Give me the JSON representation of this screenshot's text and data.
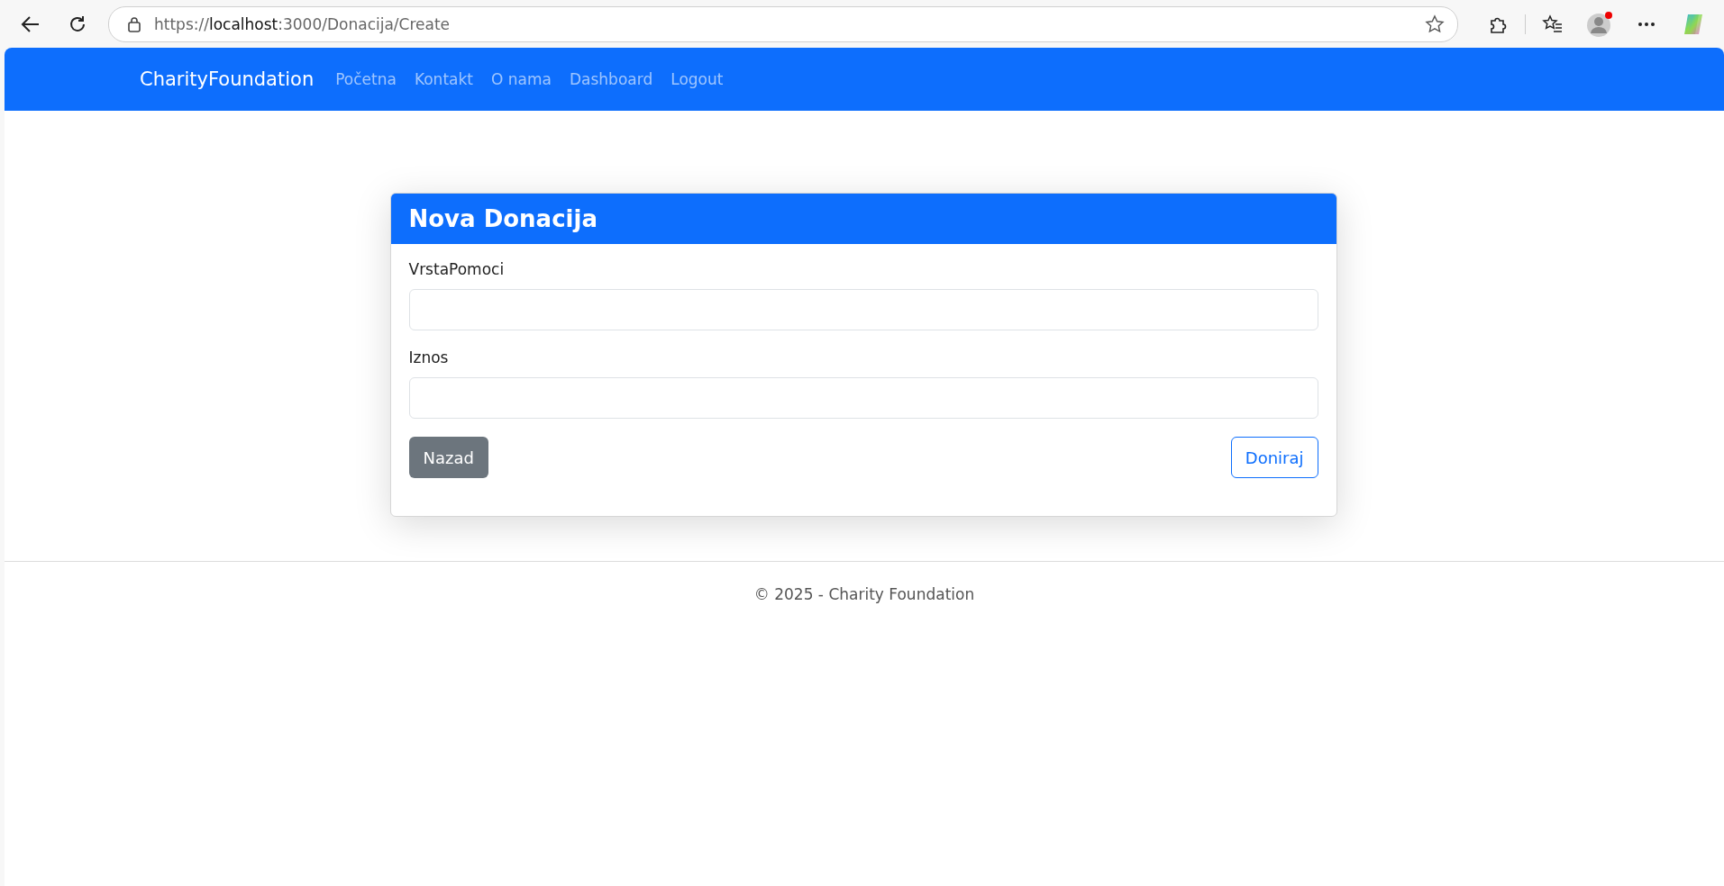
{
  "browser": {
    "url": {
      "scheme": "https://",
      "host": "localhost",
      "path": ":3000/Donacija/Create"
    }
  },
  "navbar": {
    "brand": "CharityFoundation",
    "links": [
      "Početna",
      "Kontakt",
      "O nama",
      "Dashboard",
      "Logout"
    ]
  },
  "card": {
    "title": "Nova Donacija",
    "fields": [
      {
        "label": "VrstaPomoci"
      },
      {
        "label": "Iznos"
      }
    ],
    "back_button": "Nazad",
    "submit_button": "Doniraj"
  },
  "footer": {
    "text": "© 2025 - Charity Foundation"
  }
}
